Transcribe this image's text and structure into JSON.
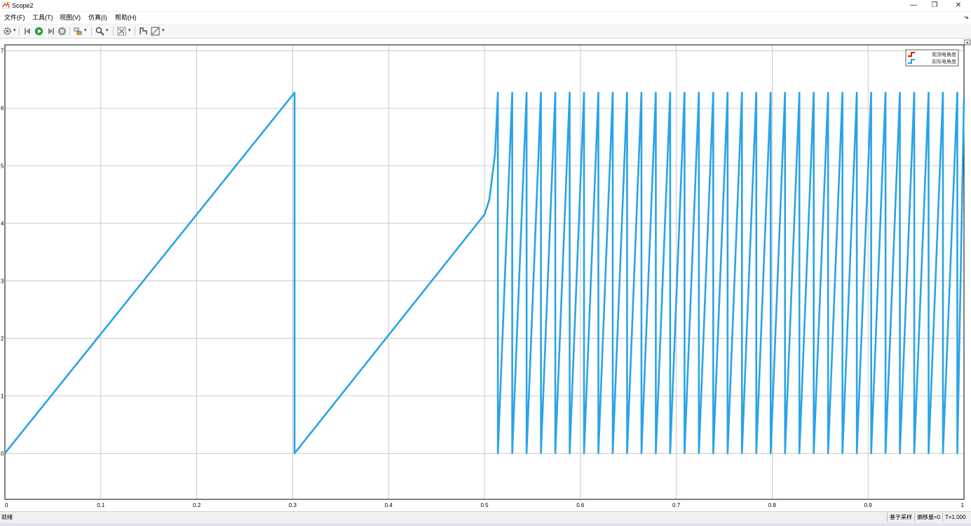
{
  "window": {
    "title": "Scope2",
    "min_icon": "—",
    "max_icon": "❐",
    "close_icon": "✕"
  },
  "menu": [
    {
      "label": "文件(F)"
    },
    {
      "label": "工具(T)"
    },
    {
      "label": "视图(V)"
    },
    {
      "label": "仿真(I)"
    },
    {
      "label": "帮助(H)"
    }
  ],
  "toolbar": {
    "icons": [
      "settings-icon",
      "step-back-icon",
      "run-icon",
      "step-forward-icon",
      "stop-icon",
      "highlight-block-icon",
      "zoom-icon",
      "autoscale-icon",
      "cursor-measure-icon",
      "signal-statistics-icon"
    ]
  },
  "legend": {
    "entries": [
      {
        "label": "观测电角度",
        "color": "#ff0000"
      },
      {
        "label": "实际电角度",
        "color": "#1f9ee8"
      }
    ]
  },
  "status": {
    "left": "就绪",
    "sample": "基于采样",
    "offset": "偏移量=0",
    "time": "T=1.000"
  },
  "chart_data": {
    "type": "line",
    "xlim": [
      0,
      1
    ],
    "ylim": [
      -0.8,
      7.1
    ],
    "x_ticks": [
      "0",
      "0.1",
      "0.2",
      "0.3",
      "0.4",
      "0.5",
      "0.6",
      "0.7",
      "0.8",
      "0.9",
      "1"
    ],
    "y_ticks": [
      "0",
      "1",
      "2",
      "3",
      "4",
      "5",
      "6",
      "7"
    ],
    "grid": true,
    "legend_position": "top-right",
    "colors": {
      "series": "#2aa3e6",
      "grid": "#bdbdbd",
      "axes": "#000000"
    },
    "series": [
      {
        "name": "实际电角度",
        "description_points": [
          [
            0,
            0
          ],
          [
            0.302,
            6.27
          ],
          [
            0.302,
            0
          ],
          [
            0.5,
            4.15
          ],
          [
            0.505,
            4.4
          ],
          [
            0.511,
            5.2
          ],
          [
            0.514,
            6.27
          ],
          [
            0.514,
            0
          ]
        ],
        "fast_segment": {
          "x_start": 0.514,
          "x_end": 1.0,
          "period": 0.01497,
          "peak": 6.27,
          "final_y": 6.17
        }
      }
    ]
  }
}
